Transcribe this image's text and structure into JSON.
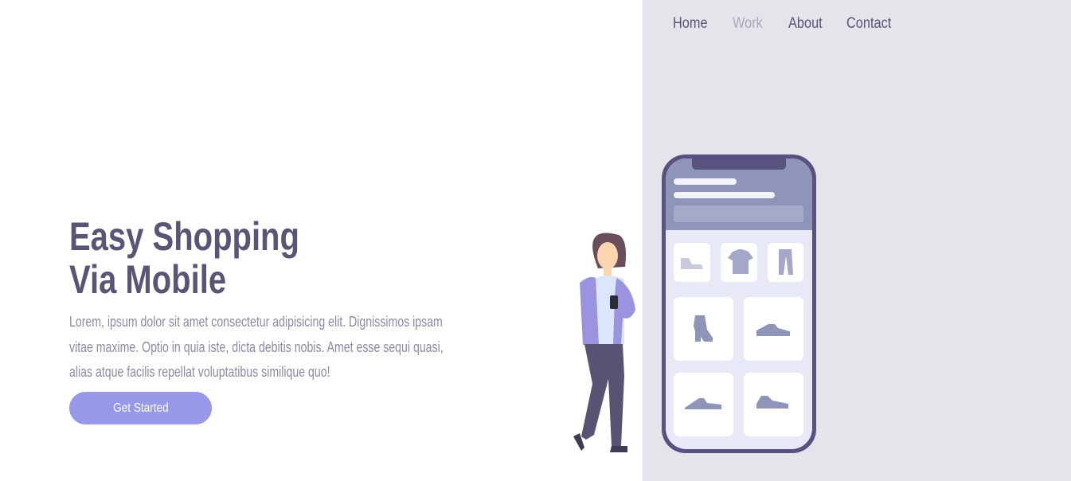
{
  "nav": {
    "items": [
      {
        "label": "Home",
        "active": false
      },
      {
        "label": "Work",
        "active": true
      },
      {
        "label": "About",
        "active": false
      },
      {
        "label": "Contact",
        "active": false
      }
    ]
  },
  "hero": {
    "title_line1": "Easy Shopping",
    "title_line2": "Via Mobile",
    "body": "Lorem, ipsum dolor sit amet consectetur adipisicing elit. Dignissimos ipsam vitae maxime. Optio in quia iste, dicta debitis nobis. Amet esse sequi quasi, alias atque facilis repellat voluptatibus similique quo!",
    "cta_label": "Get Started"
  },
  "illustration": {
    "icons": [
      "shoe-icon",
      "tshirt-icon",
      "pants-icon",
      "boot-icon",
      "sneaker-icon",
      "sneaker-icon",
      "sneaker-icon"
    ]
  },
  "colors": {
    "primary_text": "#585674",
    "muted_text": "#8c8aa5",
    "accent": "#9799e8",
    "panel_bg": "#e5e4ea",
    "phone_frame": "#585280",
    "phone_header": "#8f95b8"
  }
}
